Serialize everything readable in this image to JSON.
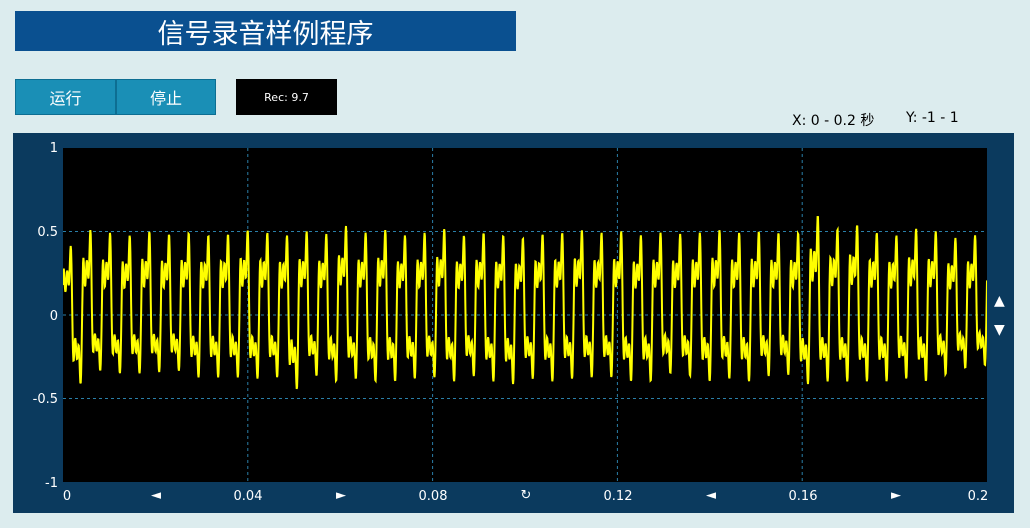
{
  "title": "信号录音样例程序",
  "toolbar": {
    "run_label": "运行",
    "stop_label": "停止",
    "rec_label": "Rec: 9.7"
  },
  "ranges": {
    "x_label": "X: 0 - 0.2 秒",
    "y_label": "Y: -1 - 1"
  },
  "chart_data": {
    "type": "line",
    "title": "",
    "xlabel": "",
    "ylabel": "",
    "xlim": [
      0,
      0.2
    ],
    "ylim": [
      -1,
      1
    ],
    "grid": true,
    "x_ticks": [
      "0",
      "0.04",
      "0.08",
      "0.12",
      "0.16",
      "0.2"
    ],
    "y_ticks": [
      "1",
      "0.5",
      "0",
      "-0.5",
      "-1"
    ],
    "series": [
      {
        "color": "#ffff00",
        "description_of_shape": "periodic waveform ~225 Hz fundamental with harmonic content",
        "peak_values": [
          0.52,
          0.64,
          0.62,
          0.6,
          0.63,
          0.61,
          0.62,
          0.6,
          0.61,
          0.64,
          0.62,
          0.6,
          0.63,
          0.61,
          0.67,
          0.62,
          0.64,
          0.6,
          0.62,
          0.65,
          0.6,
          0.62,
          0.6,
          0.58,
          0.61,
          0.62,
          0.64,
          0.62,
          0.63,
          0.6,
          0.62,
          0.61,
          0.62,
          0.64,
          0.62,
          0.63,
          0.62,
          0.62,
          0.75,
          0.65,
          0.68,
          0.62,
          0.6,
          0.65,
          0.63,
          0.58,
          0.6
        ],
        "trough_values": [
          -0.52,
          -0.42,
          -0.44,
          -0.44,
          -0.43,
          -0.42,
          -0.47,
          -0.47,
          -0.47,
          -0.48,
          -0.47,
          -0.56,
          -0.46,
          -0.5,
          -0.48,
          -0.5,
          -0.5,
          -0.48,
          -0.47,
          -0.5,
          -0.46,
          -0.5,
          -0.52,
          -0.48,
          -0.5,
          -0.48,
          -0.47,
          -0.47,
          -0.5,
          -0.5,
          -0.44,
          -0.46,
          -0.5,
          -0.48,
          -0.5,
          -0.46,
          -0.45,
          -0.52,
          -0.5,
          -0.5,
          -0.5,
          -0.5,
          -0.48,
          -0.5,
          -0.45,
          -0.4,
          -0.38
        ]
      }
    ]
  },
  "controls": {
    "scroll_left": "◄",
    "scroll_right": "►",
    "reset": "↻",
    "zoom_up": "▲",
    "zoom_down": "▼"
  }
}
